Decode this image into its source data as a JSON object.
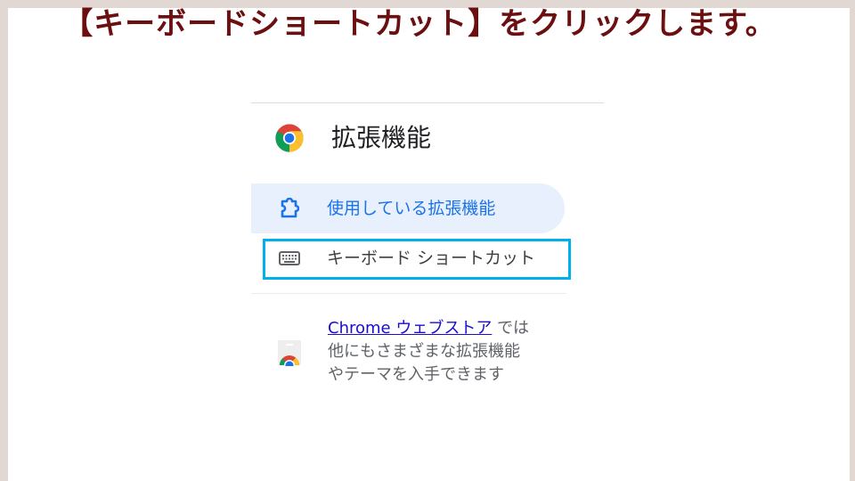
{
  "instruction": "【キーボードショートカット】をクリックします。",
  "panel": {
    "title": "拡張機能",
    "logo_icon": "chrome-logo-icon",
    "nav_items": [
      {
        "label": "使用している拡張機能",
        "icon": "puzzle-piece-icon",
        "active": true
      },
      {
        "label": "キーボード ショートカット",
        "icon": "keyboard-icon",
        "active": false,
        "highlighted": true
      }
    ],
    "store_promo": {
      "icon": "chrome-web-store-icon",
      "link_text": "Chrome ウェブストア",
      "line1_suffix": " では",
      "line2": "他にもさまざまな拡張機能",
      "line3": "やテーマを入手できます"
    }
  },
  "colors": {
    "instruction_text": "#6b0f10",
    "highlight_border": "#00b0ec",
    "active_nav_bg": "#e8f0fe",
    "active_nav_text": "#1a73e8",
    "link": "#1a0dcc",
    "frame": "#e2d8d3"
  }
}
